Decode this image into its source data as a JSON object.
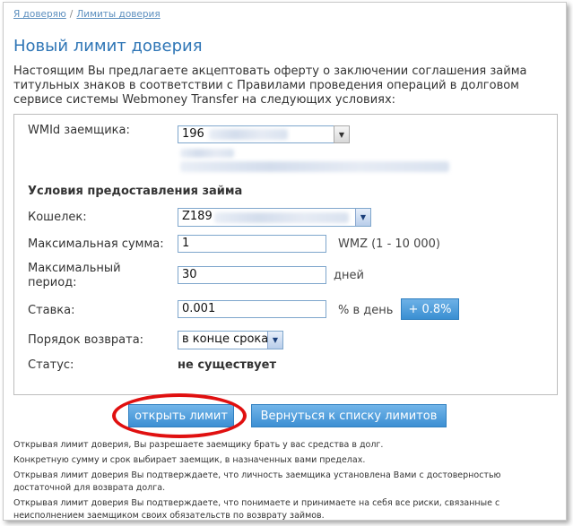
{
  "breadcrumb": {
    "item1": "Я доверяю",
    "separator": "/",
    "item2": "Лимиты доверия"
  },
  "page_title": "Новый лимит доверия",
  "intro": "Настоящим Вы предлагаете акцептовать оферту о заключении соглашения займа титульных знаков в соответствии с Правилами проведения операций в долговом сервисе системы Webmoney Transfer на следующих условиях:",
  "form": {
    "wmid_label": "WMId заемщика:",
    "wmid_value": "196",
    "section_title": "Условия предоставления займа",
    "purse_label": "Кошелек:",
    "purse_value": "Z189",
    "max_sum_label": "Максимальная сумма:",
    "max_sum_value": "1",
    "max_sum_hint": "WMZ (1 - 10 000)",
    "max_period_label_line1": "Максимальный",
    "max_period_label_line2": "период:",
    "max_period_value": "30",
    "max_period_unit": "дней",
    "rate_label": "Ставка:",
    "rate_value": "0.001",
    "rate_unit": "% в день",
    "rate_button": "+ 0.8%",
    "return_order_label": "Порядок возврата:",
    "return_order_value": "в конце срока",
    "status_label": "Статус:",
    "status_value": "не существует"
  },
  "buttons": {
    "open_limit": "открыть лимит",
    "back_to_list": "Вернуться к списку лимитов"
  },
  "notes": [
    "Открывая лимит доверия, Вы разрешаете заемщику брать у вас средства в долг.",
    "Конкретную сумму и срок выбирает заемщик, в назначенных вами пределах.",
    "Открывая лимит доверия Вы подтверждаете, что личность заемщика установлена Вами с достоверностью достаточной для возврата долга.",
    "Открывая лимит доверия Вы подтверждаете, что понимаете и принимаете на себя все риски, связанные с неисполнением заемщиком своих обязательств по возврату займов."
  ],
  "colors": {
    "title": "#2f76b6",
    "button": "#3c8fd3",
    "highlight_ring": "#e01010",
    "link": "#5c8fbf"
  },
  "icons": {
    "dropdown": "chevron-down-icon"
  }
}
